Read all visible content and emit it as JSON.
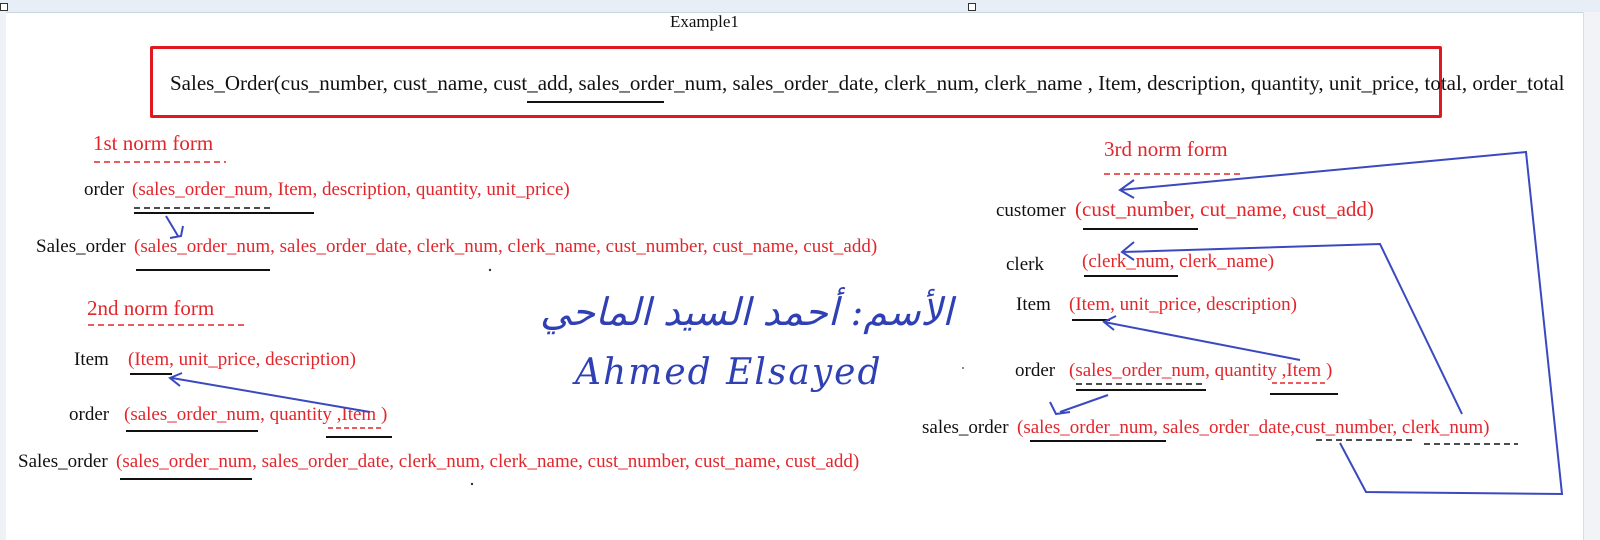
{
  "title": "Example1",
  "main_relation": {
    "name": "Sales_Order(cus_number, cust_name, cust_add, ",
    "key": "sales_order_num",
    "rest": ", sales_order_date, clerk_num, clerk_name , Item, description, quantity, unit_price, total, ",
    "order_total": "order_total"
  },
  "first_nf": {
    "heading": "1st norm form",
    "rows": [
      {
        "label": "order",
        "attrs": "(sales_order_num, Item, description, quantity, unit_price)"
      },
      {
        "label": "Sales_order",
        "attrs": "(sales_order_num, sales_order_date, clerk_num, clerk_name, cust_number, cust_name, cust_add)"
      }
    ]
  },
  "second_nf": {
    "heading": "2nd norm form",
    "rows": [
      {
        "label": "Item",
        "attrs": "(Item, unit_price, description)"
      },
      {
        "label": "order",
        "attrs": "(sales_order_num, quantity ,Item   )"
      },
      {
        "label": "Sales_order",
        "attrs": "(sales_order_num, sales_order_date, clerk_num, clerk_name, cust_number, cust_name, cust_add)"
      }
    ]
  },
  "third_nf": {
    "heading": "3rd norm form",
    "rows": [
      {
        "label": "customer",
        "attrs": "(cust_number, cut_name, cust_add)"
      },
      {
        "label": "clerk",
        "attrs": "(clerk_num, clerk_name)"
      },
      {
        "label": "Item",
        "attrs": "(Item, unit_price, description)"
      },
      {
        "label": "order",
        "attrs": "(sales_order_num, quantity ,Item   )"
      },
      {
        "label": "sales_order",
        "attrs": "(sales_order_num, sales_order_date,cust_number, clerk_num)"
      }
    ]
  },
  "signature": {
    "arabic": "الأسم: أحمد السيد الماحي",
    "latin": "Ahmed Elsayed"
  },
  "colors": {
    "attr_red": "#e2262c",
    "box_red": "#e0181f",
    "ink_blue": "#3a49c0"
  }
}
